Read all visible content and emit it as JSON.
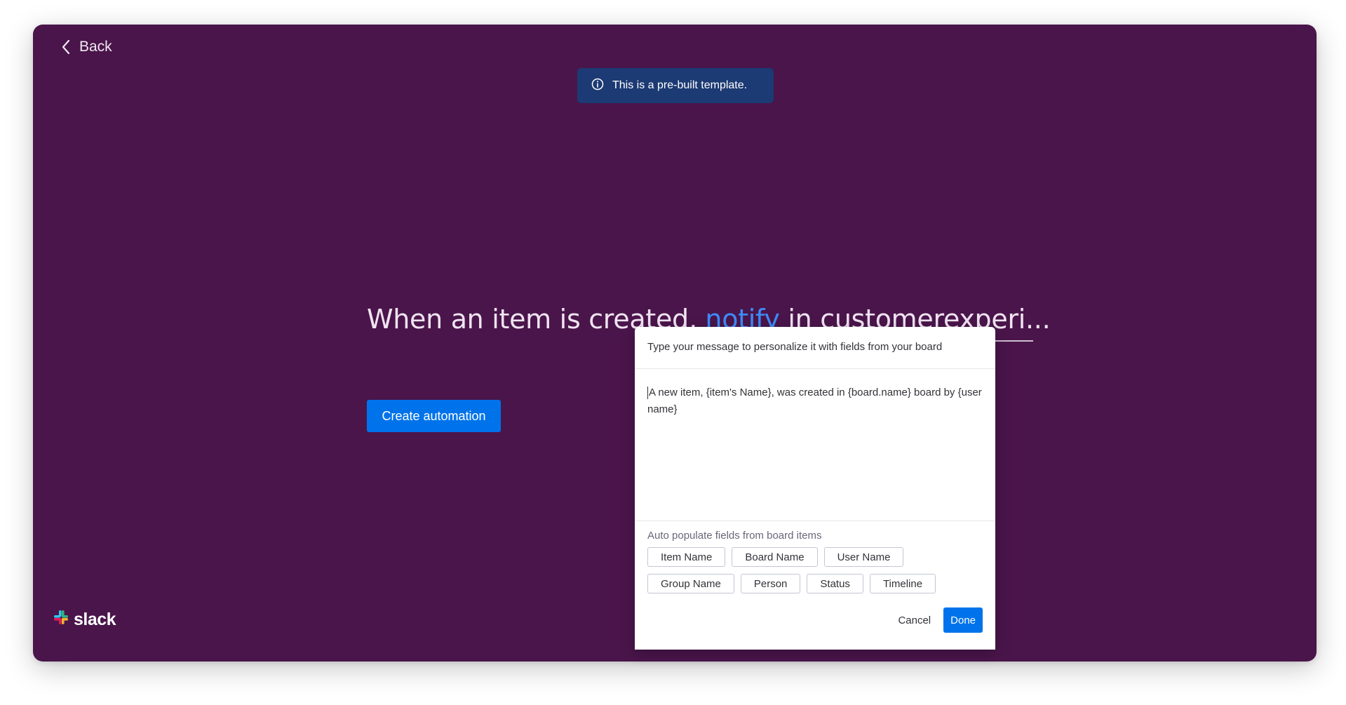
{
  "nav": {
    "back_label": "Back"
  },
  "banner": {
    "text": "This is a pre-built template.",
    "icon": "info-icon"
  },
  "recipe": {
    "part1": "When an item is created, ",
    "action": "notify",
    "part2": " in ",
    "channel": "customerexperi..."
  },
  "create_button_label": "Create automation",
  "brand": {
    "name": "slack",
    "icon": "slack-hash-icon"
  },
  "message_panel": {
    "header": "Type your message to personalize it with fields from your board",
    "message": "A new item, {item's Name}, was created in {board.name} board by {user name}",
    "fields_label": "Auto populate fields from board items",
    "fields": [
      "Item Name",
      "Board Name",
      "User Name",
      "Group Name",
      "Person",
      "Status",
      "Timeline"
    ],
    "cancel_label": "Cancel",
    "done_label": "Done"
  },
  "colors": {
    "background": "#4a154b",
    "accent": "#0073ea",
    "banner": "#1c3a73",
    "action_text": "#3d8bf7"
  }
}
